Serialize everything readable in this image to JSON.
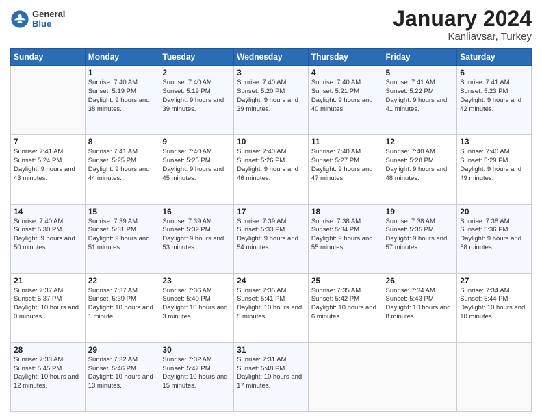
{
  "logo": {
    "general": "General",
    "blue": "Blue"
  },
  "header": {
    "month_year": "January 2024",
    "location": "Kanliavsar, Turkey"
  },
  "days_of_week": [
    "Sunday",
    "Monday",
    "Tuesday",
    "Wednesday",
    "Thursday",
    "Friday",
    "Saturday"
  ],
  "weeks": [
    [
      {
        "day": "",
        "sunrise": "",
        "sunset": "",
        "daylight": ""
      },
      {
        "day": "1",
        "sunrise": "Sunrise: 7:40 AM",
        "sunset": "Sunset: 5:19 PM",
        "daylight": "Daylight: 9 hours and 38 minutes."
      },
      {
        "day": "2",
        "sunrise": "Sunrise: 7:40 AM",
        "sunset": "Sunset: 5:19 PM",
        "daylight": "Daylight: 9 hours and 39 minutes."
      },
      {
        "day": "3",
        "sunrise": "Sunrise: 7:40 AM",
        "sunset": "Sunset: 5:20 PM",
        "daylight": "Daylight: 9 hours and 39 minutes."
      },
      {
        "day": "4",
        "sunrise": "Sunrise: 7:40 AM",
        "sunset": "Sunset: 5:21 PM",
        "daylight": "Daylight: 9 hours and 40 minutes."
      },
      {
        "day": "5",
        "sunrise": "Sunrise: 7:41 AM",
        "sunset": "Sunset: 5:22 PM",
        "daylight": "Daylight: 9 hours and 41 minutes."
      },
      {
        "day": "6",
        "sunrise": "Sunrise: 7:41 AM",
        "sunset": "Sunset: 5:23 PM",
        "daylight": "Daylight: 9 hours and 42 minutes."
      }
    ],
    [
      {
        "day": "7",
        "sunrise": "Sunrise: 7:41 AM",
        "sunset": "Sunset: 5:24 PM",
        "daylight": "Daylight: 9 hours and 43 minutes."
      },
      {
        "day": "8",
        "sunrise": "Sunrise: 7:41 AM",
        "sunset": "Sunset: 5:25 PM",
        "daylight": "Daylight: 9 hours and 44 minutes."
      },
      {
        "day": "9",
        "sunrise": "Sunrise: 7:40 AM",
        "sunset": "Sunset: 5:25 PM",
        "daylight": "Daylight: 9 hours and 45 minutes."
      },
      {
        "day": "10",
        "sunrise": "Sunrise: 7:40 AM",
        "sunset": "Sunset: 5:26 PM",
        "daylight": "Daylight: 9 hours and 46 minutes."
      },
      {
        "day": "11",
        "sunrise": "Sunrise: 7:40 AM",
        "sunset": "Sunset: 5:27 PM",
        "daylight": "Daylight: 9 hours and 47 minutes."
      },
      {
        "day": "12",
        "sunrise": "Sunrise: 7:40 AM",
        "sunset": "Sunset: 5:28 PM",
        "daylight": "Daylight: 9 hours and 48 minutes."
      },
      {
        "day": "13",
        "sunrise": "Sunrise: 7:40 AM",
        "sunset": "Sunset: 5:29 PM",
        "daylight": "Daylight: 9 hours and 49 minutes."
      }
    ],
    [
      {
        "day": "14",
        "sunrise": "Sunrise: 7:40 AM",
        "sunset": "Sunset: 5:30 PM",
        "daylight": "Daylight: 9 hours and 50 minutes."
      },
      {
        "day": "15",
        "sunrise": "Sunrise: 7:39 AM",
        "sunset": "Sunset: 5:31 PM",
        "daylight": "Daylight: 9 hours and 51 minutes."
      },
      {
        "day": "16",
        "sunrise": "Sunrise: 7:39 AM",
        "sunset": "Sunset: 5:32 PM",
        "daylight": "Daylight: 9 hours and 53 minutes."
      },
      {
        "day": "17",
        "sunrise": "Sunrise: 7:39 AM",
        "sunset": "Sunset: 5:33 PM",
        "daylight": "Daylight: 9 hours and 54 minutes."
      },
      {
        "day": "18",
        "sunrise": "Sunrise: 7:38 AM",
        "sunset": "Sunset: 5:34 PM",
        "daylight": "Daylight: 9 hours and 55 minutes."
      },
      {
        "day": "19",
        "sunrise": "Sunrise: 7:38 AM",
        "sunset": "Sunset: 5:35 PM",
        "daylight": "Daylight: 9 hours and 57 minutes."
      },
      {
        "day": "20",
        "sunrise": "Sunrise: 7:38 AM",
        "sunset": "Sunset: 5:36 PM",
        "daylight": "Daylight: 9 hours and 58 minutes."
      }
    ],
    [
      {
        "day": "21",
        "sunrise": "Sunrise: 7:37 AM",
        "sunset": "Sunset: 5:37 PM",
        "daylight": "Daylight: 10 hours and 0 minutes."
      },
      {
        "day": "22",
        "sunrise": "Sunrise: 7:37 AM",
        "sunset": "Sunset: 5:39 PM",
        "daylight": "Daylight: 10 hours and 1 minute."
      },
      {
        "day": "23",
        "sunrise": "Sunrise: 7:36 AM",
        "sunset": "Sunset: 5:40 PM",
        "daylight": "Daylight: 10 hours and 3 minutes."
      },
      {
        "day": "24",
        "sunrise": "Sunrise: 7:35 AM",
        "sunset": "Sunset: 5:41 PM",
        "daylight": "Daylight: 10 hours and 5 minutes."
      },
      {
        "day": "25",
        "sunrise": "Sunrise: 7:35 AM",
        "sunset": "Sunset: 5:42 PM",
        "daylight": "Daylight: 10 hours and 6 minutes."
      },
      {
        "day": "26",
        "sunrise": "Sunrise: 7:34 AM",
        "sunset": "Sunset: 5:43 PM",
        "daylight": "Daylight: 10 hours and 8 minutes."
      },
      {
        "day": "27",
        "sunrise": "Sunrise: 7:34 AM",
        "sunset": "Sunset: 5:44 PM",
        "daylight": "Daylight: 10 hours and 10 minutes."
      }
    ],
    [
      {
        "day": "28",
        "sunrise": "Sunrise: 7:33 AM",
        "sunset": "Sunset: 5:45 PM",
        "daylight": "Daylight: 10 hours and 12 minutes."
      },
      {
        "day": "29",
        "sunrise": "Sunrise: 7:32 AM",
        "sunset": "Sunset: 5:46 PM",
        "daylight": "Daylight: 10 hours and 13 minutes."
      },
      {
        "day": "30",
        "sunrise": "Sunrise: 7:32 AM",
        "sunset": "Sunset: 5:47 PM",
        "daylight": "Daylight: 10 hours and 15 minutes."
      },
      {
        "day": "31",
        "sunrise": "Sunrise: 7:31 AM",
        "sunset": "Sunset: 5:48 PM",
        "daylight": "Daylight: 10 hours and 17 minutes."
      },
      {
        "day": "",
        "sunrise": "",
        "sunset": "",
        "daylight": ""
      },
      {
        "day": "",
        "sunrise": "",
        "sunset": "",
        "daylight": ""
      },
      {
        "day": "",
        "sunrise": "",
        "sunset": "",
        "daylight": ""
      }
    ]
  ]
}
